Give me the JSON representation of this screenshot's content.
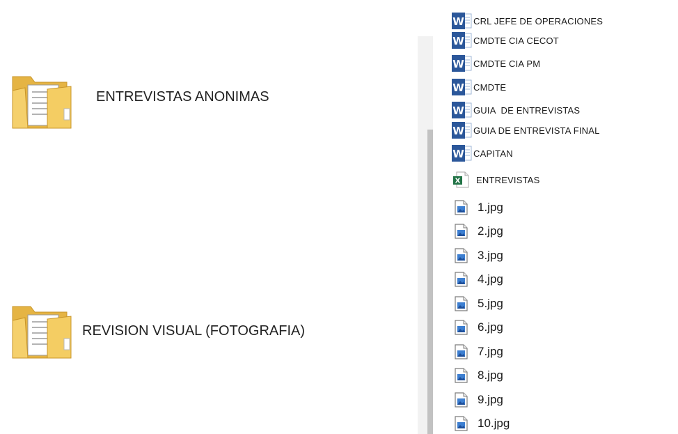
{
  "folders": [
    {
      "name": "ENTREVISTAS ANONIMAS",
      "icon": "folder-icon"
    },
    {
      "name": "REVISION VISUAL (FOTOGRAFIA)",
      "icon": "folder-icon"
    }
  ],
  "documents": [
    {
      "name": "CRL JEFE DE OPERACIONES",
      "icon": "word-document-icon"
    },
    {
      "name": "CMDTE CIA CECOT",
      "icon": "word-document-icon"
    },
    {
      "name": "CMDTE CIA PM",
      "icon": "word-document-icon"
    },
    {
      "name": "CMDTE",
      "icon": "word-document-icon"
    },
    {
      "name": "GUIA  DE ENTREVISTAS",
      "icon": "word-document-icon"
    },
    {
      "name": "GUIA DE ENTREVISTA FINAL",
      "icon": "word-document-icon"
    },
    {
      "name": "CAPITAN",
      "icon": "word-document-icon"
    },
    {
      "name": "ENTREVISTAS",
      "icon": "excel-spreadsheet-icon"
    }
  ],
  "images": [
    {
      "name": "1.jpg",
      "icon": "image-file-icon"
    },
    {
      "name": "2.jpg",
      "icon": "image-file-icon"
    },
    {
      "name": "3.jpg",
      "icon": "image-file-icon"
    },
    {
      "name": "4.jpg",
      "icon": "image-file-icon"
    },
    {
      "name": "5.jpg",
      "icon": "image-file-icon"
    },
    {
      "name": "6.jpg",
      "icon": "image-file-icon"
    },
    {
      "name": "7.jpg",
      "icon": "image-file-icon"
    },
    {
      "name": "8.jpg",
      "icon": "image-file-icon"
    },
    {
      "name": "9.jpg",
      "icon": "image-file-icon"
    },
    {
      "name": "10.jpg",
      "icon": "image-file-icon"
    }
  ],
  "colors": {
    "word_blue": "#2b579a",
    "excel_green": "#217346",
    "folder_yellow": "#f0c65a",
    "image_blue": "#3d7fd1"
  }
}
